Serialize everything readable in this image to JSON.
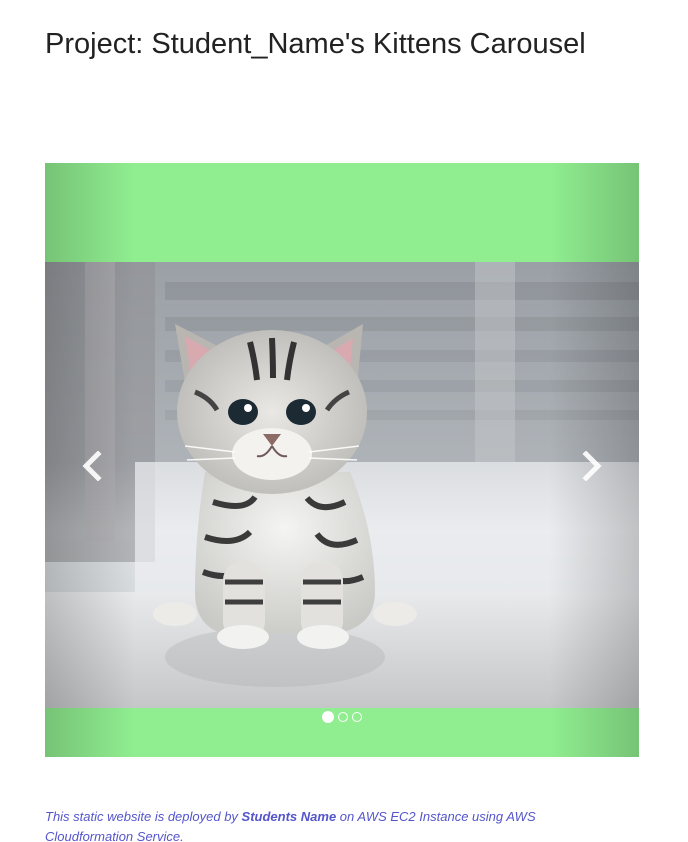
{
  "header": {
    "title": "Project: Student_Name's Kittens Carousel"
  },
  "carousel": {
    "background_color": "#90ee90",
    "active_slide_index": 0,
    "slide_count": 3,
    "slide_subject": "tabby-kitten-photo",
    "prev_icon": "chevron-left-icon",
    "next_icon": "chevron-right-icon"
  },
  "footer": {
    "text_before": "This static website is deployed by ",
    "author": "Students Name",
    "text_after": " on AWS EC2 Instance using AWS Cloudformation Service.",
    "color": "#5555cc"
  }
}
